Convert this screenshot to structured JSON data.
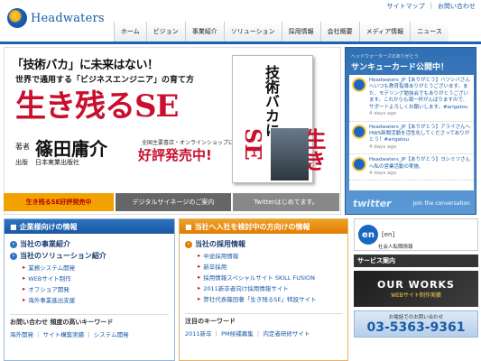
{
  "brand": {
    "name": "Headwaters"
  },
  "util": {
    "sitemap": "サイトマップ",
    "contact": "お問い合わせ",
    "sep": "|"
  },
  "nav": [
    {
      "label": "ホーム"
    },
    {
      "label": "ビジョン"
    },
    {
      "label": "事業紹介"
    },
    {
      "label": "ソリューション"
    },
    {
      "label": "採用情報"
    },
    {
      "label": "会社概要"
    },
    {
      "label": "メディア情報"
    },
    {
      "label": "ニュース"
    }
  ],
  "hero": {
    "catch": "「技術バカ」に未来はない！",
    "sub": "世界で通用する「ビジネスエンジニア」の育て方",
    "title": "生き残るSE",
    "author_label": "著者",
    "author": "篠田庸介",
    "publisher_label": "出版",
    "publisher": "日本実業出版社",
    "shops": "全国主要書店・オンラインショップにて",
    "sale": "好評発売中!",
    "book_title": "技術バカに",
    "book_big": "生き残るSE"
  },
  "hero_tabs": [
    {
      "label": "生き残るSE好評発売中"
    },
    {
      "label": "デジタルサイネージのご案内"
    },
    {
      "label": "Twitterはじめてます。"
    }
  ],
  "twitter": {
    "header": "ヘッドウォーターズのありがとう",
    "title": "サンキューカード公開中！",
    "tweets": [
      {
        "text": "Headwaters_JP【ありがとう】ハツシバさんへいつも教育指導ありがとうございます。また、モデリング勉強会でもありがとうございます。これからも頑一杯がんばりますので、サポートよろしくお願いします。#arigatou",
        "ago": "4 days ago"
      },
      {
        "text": "Headwaters_JP【ありがとう】アライさんへHWS新聞活動を活性化してくださってありがとう！#arigatou",
        "ago": "4 days ago"
      },
      {
        "text": "Headwaters_JP【ありがとう】ヨシミツさんへ私の営業活動の実施、",
        "ago": "4 days ago"
      }
    ],
    "logo": "twitter",
    "join": "Join the conversation"
  },
  "corp": {
    "header": "企業様向けの情報",
    "items": [
      {
        "label": "当社の事業紹介",
        "type": "main"
      },
      {
        "label": "当社のソリューション紹介",
        "type": "main"
      },
      {
        "label": "業務システム開発",
        "type": "sub"
      },
      {
        "label": "WEBサイト制作",
        "type": "sub"
      },
      {
        "label": "オフショア開発",
        "type": "sub"
      },
      {
        "label": "海外事業進出支援",
        "type": "sub"
      }
    ],
    "kw_header": "お問い合わせ 頻度の高いキーワード",
    "keywords": "海外開発 ｜ サイト構築実績 ｜ システム開発"
  },
  "recruit": {
    "header": "当社へ入社を検討中の方向けの情報",
    "items": [
      {
        "label": "当社の採用情報",
        "type": "main"
      },
      {
        "label": "中途採用情報",
        "type": "sub"
      },
      {
        "label": "新卒採用",
        "type": "sub"
      },
      {
        "label": "採用情報スペシャルサイト SKILL FUSION",
        "type": "sub"
      },
      {
        "label": "2011新卒者向け採用情報サイト",
        "type": "sub"
      },
      {
        "label": "弊社代表篠田著「生き残るSE」特設サイト",
        "type": "sub"
      }
    ],
    "kw_header": "注目のキーワード",
    "keywords": "2011新卒 ｜ PM候補募集 ｜ 内定者研修サイト"
  },
  "right": {
    "en_logo": "en",
    "en_name": "[en]",
    "en_desc": "社会人転職情報",
    "svc_header": "サービス案内",
    "works_title": "OUR WORKS",
    "works_sub": "WEBサイト制作実績",
    "phone_label": "お電話でのお問い合わせ",
    "phone": "03-5363-9361"
  },
  "colors": {
    "brand_blue": "#1a63b3",
    "accent_red": "#c8102e",
    "orange": "#e07c00"
  }
}
